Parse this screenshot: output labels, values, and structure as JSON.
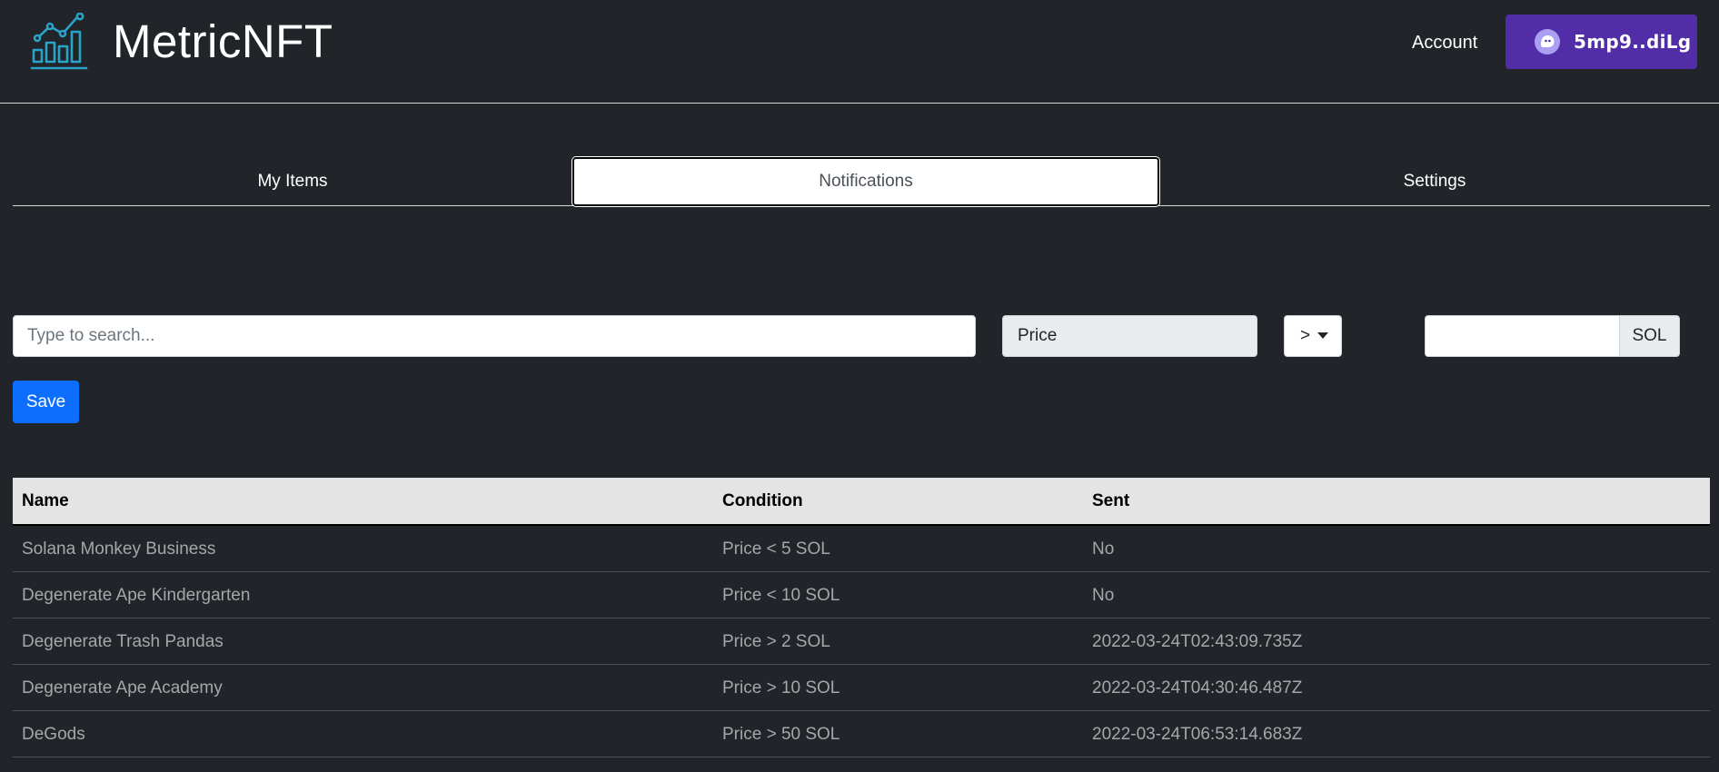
{
  "header": {
    "brand": "MetricNFT",
    "account_label": "Account",
    "wallet_address": "5mp9..diLg"
  },
  "tabs": [
    {
      "label": "My Items",
      "active": false
    },
    {
      "label": "Notifications",
      "active": true
    },
    {
      "label": "Settings",
      "active": false
    }
  ],
  "form": {
    "search_placeholder": "Type to search...",
    "search_value": "",
    "metric_label": "Price",
    "operator": ">",
    "value": "",
    "unit": "SOL",
    "save_label": "Save"
  },
  "table": {
    "columns": [
      "Name",
      "Condition",
      "Sent"
    ],
    "rows": [
      {
        "name": "Solana Monkey Business",
        "condition": "Price < 5 SOL",
        "sent": "No"
      },
      {
        "name": "Degenerate Ape Kindergarten",
        "condition": "Price < 10 SOL",
        "sent": "No"
      },
      {
        "name": "Degenerate Trash Pandas",
        "condition": "Price > 2 SOL",
        "sent": "2022-03-24T02:43:09.735Z"
      },
      {
        "name": "Degenerate Ape Academy",
        "condition": "Price > 10 SOL",
        "sent": "2022-03-24T04:30:46.487Z"
      },
      {
        "name": "DeGods",
        "condition": "Price > 50 SOL",
        "sent": "2022-03-24T06:53:14.683Z"
      }
    ]
  },
  "colors": {
    "background": "#212429",
    "wallet_button": "#512da8",
    "save_button": "#0d6efd",
    "logo": "#2aa3c9"
  },
  "icons": {
    "logo": "chart-growth-icon",
    "wallet": "ghost-icon",
    "operator": "caret-down-icon"
  }
}
